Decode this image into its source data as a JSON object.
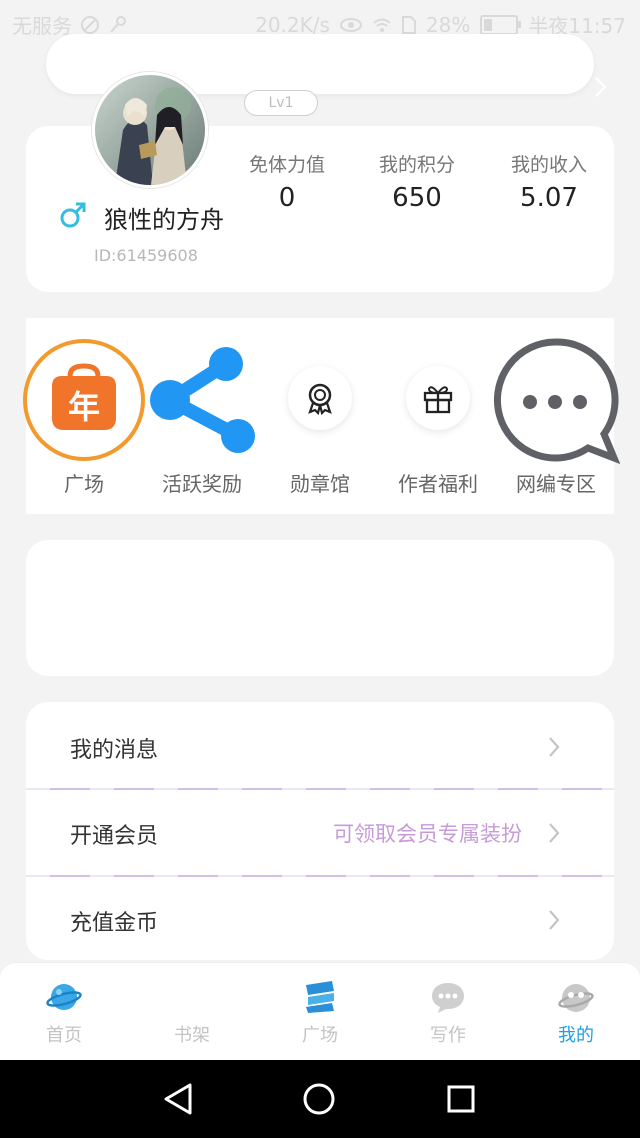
{
  "status_bar": {
    "carrier": "无服务",
    "speed": "20.2K/s",
    "battery": "28%",
    "battery_level": 0.28,
    "time": "半夜11:57"
  },
  "profile": {
    "level": "Lv1",
    "name": "狼性的方舟",
    "id": "ID:61459608",
    "stats": [
      {
        "label": "免体力值",
        "value": "0"
      },
      {
        "label": "我的积分",
        "value": "650"
      },
      {
        "label": "我的收入",
        "value": "5.07"
      }
    ]
  },
  "features": [
    {
      "label": "广场",
      "icon": "year-icon"
    },
    {
      "label": "活跃奖励",
      "icon": "share-icon"
    },
    {
      "label": "勋章馆",
      "icon": "medal-icon"
    },
    {
      "label": "作者福利",
      "icon": "gift-icon"
    },
    {
      "label": "网编专区",
      "icon": "chat-bubble-icon"
    }
  ],
  "year_glyph": "年",
  "menu": [
    {
      "label": "我的消息",
      "hint": ""
    },
    {
      "label": "开通会员",
      "hint": "可领取会员专属装扮"
    },
    {
      "label": "充值金币",
      "hint": ""
    }
  ],
  "bottom_nav": [
    {
      "label": "首页",
      "icon": "planet-icon",
      "active": false
    },
    {
      "label": "书架",
      "icon": "bookshelf-icon",
      "active": false
    },
    {
      "label": "广场",
      "icon": "square-icon",
      "active": false
    },
    {
      "label": "写作",
      "icon": "chat-write-icon",
      "active": false
    },
    {
      "label": "我的",
      "icon": "mine-icon",
      "active": true
    }
  ],
  "colors": {
    "accent_blue": "#1f9fe8",
    "orange": "#f0742a",
    "hint_purple": "#c79bd8"
  }
}
